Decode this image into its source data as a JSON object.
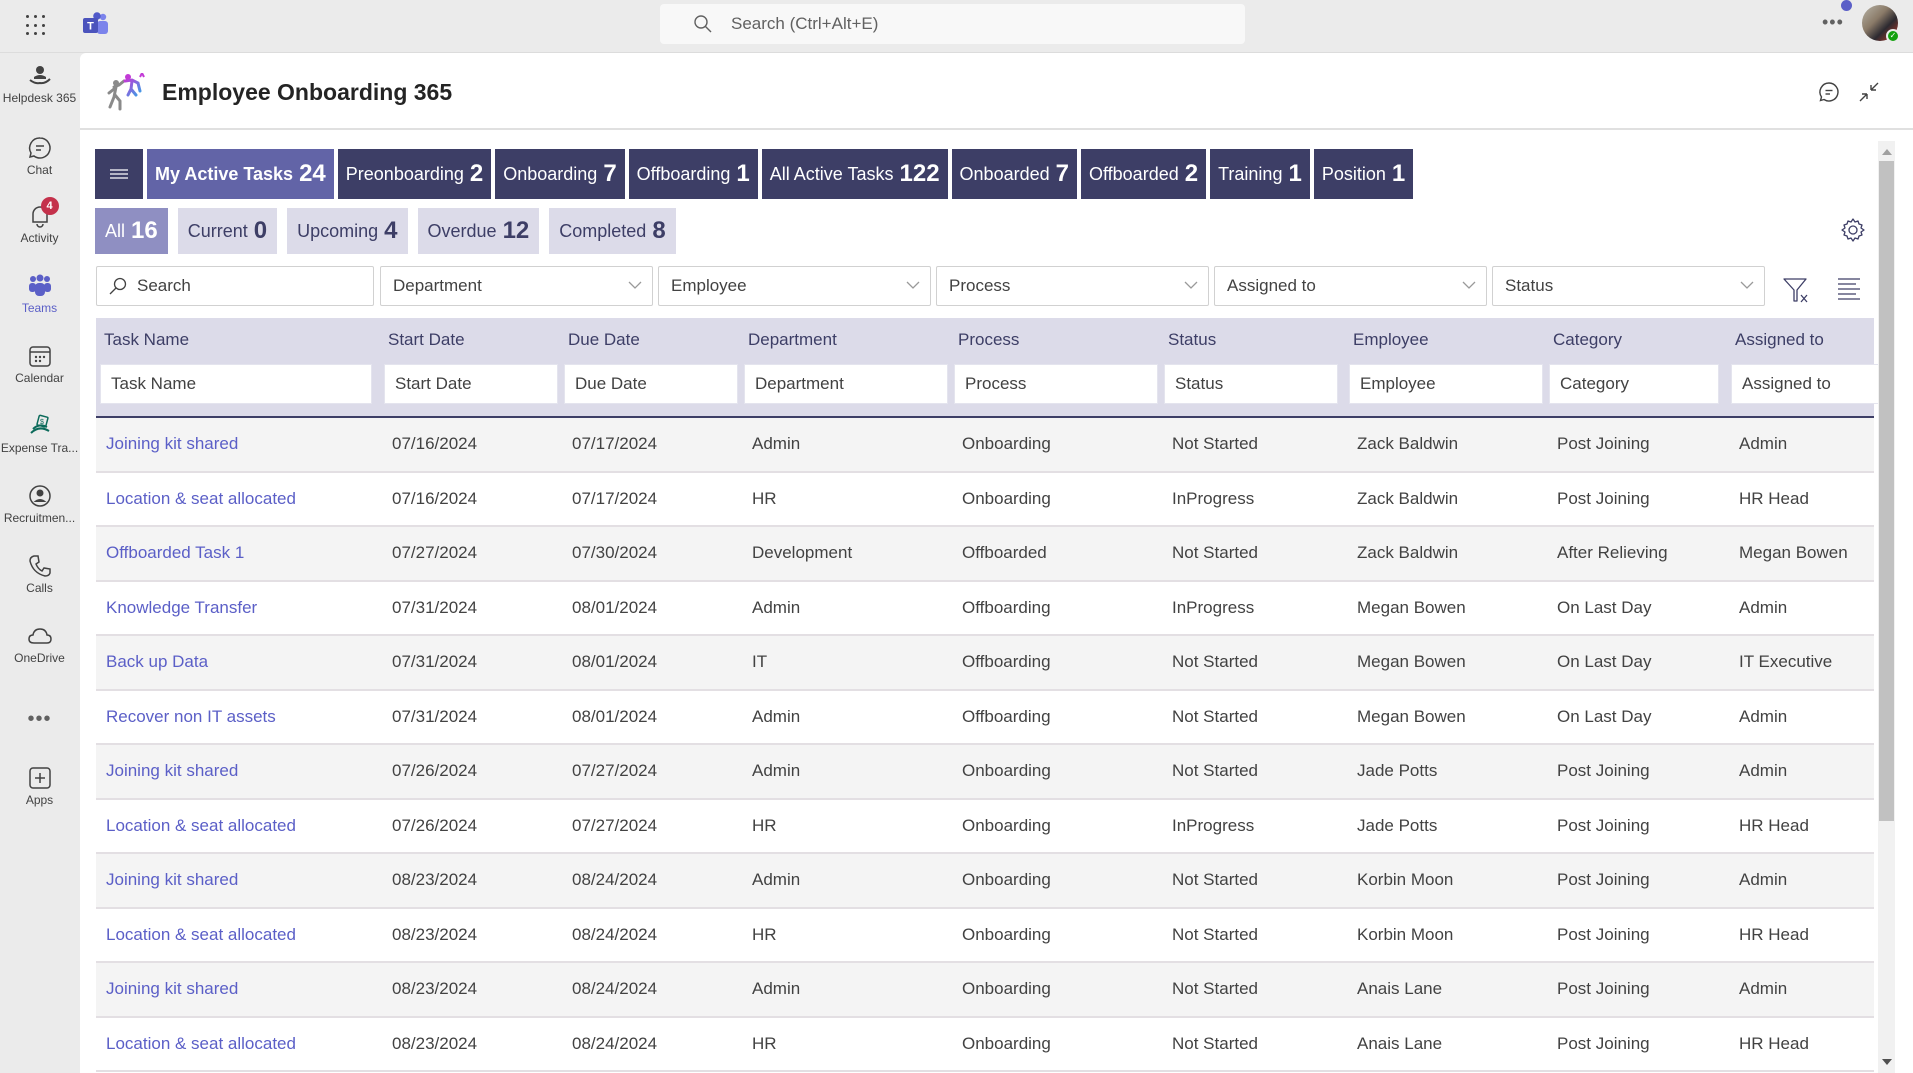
{
  "topbar": {
    "search_placeholder": "Search (Ctrl+Alt+E)",
    "more_label": "•••",
    "icons": [
      "app-launcher-icon",
      "teams-logo-icon",
      "search-icon",
      "more-icon",
      "avatar"
    ]
  },
  "sidebar": {
    "items": [
      {
        "label": "Helpdesk 365",
        "icon": "helpdesk-icon"
      },
      {
        "label": "Chat",
        "icon": "chat-icon"
      },
      {
        "label": "Activity",
        "icon": "bell-icon",
        "badge": "4"
      },
      {
        "label": "Teams",
        "icon": "teams-icon",
        "active": true
      },
      {
        "label": "Calendar",
        "icon": "calendar-icon"
      },
      {
        "label": "Expense Tra...",
        "icon": "expense-icon"
      },
      {
        "label": "Recruitmen...",
        "icon": "recruitment-icon"
      },
      {
        "label": "Calls",
        "icon": "phone-icon"
      },
      {
        "label": "OneDrive",
        "icon": "cloud-icon"
      },
      {
        "label": "Apps",
        "icon": "add-app-icon"
      }
    ],
    "more_label": "•••"
  },
  "app": {
    "title": "Employee Onboarding 365"
  },
  "tabs": [
    {
      "label": "My Active Tasks",
      "count": "24",
      "active": true
    },
    {
      "label": "Preonboarding",
      "count": "2"
    },
    {
      "label": "Onboarding",
      "count": "7"
    },
    {
      "label": "Offboarding",
      "count": "1"
    },
    {
      "label": "All Active Tasks",
      "count": "122"
    },
    {
      "label": "Onboarded",
      "count": "7"
    },
    {
      "label": "Offboarded",
      "count": "2"
    },
    {
      "label": "Training",
      "count": "1"
    },
    {
      "label": "Position",
      "count": "1"
    }
  ],
  "subtabs": [
    {
      "label": "All",
      "count": "16",
      "active": true
    },
    {
      "label": "Current",
      "count": "0"
    },
    {
      "label": "Upcoming",
      "count": "4"
    },
    {
      "label": "Overdue",
      "count": "12"
    },
    {
      "label": "Completed",
      "count": "8"
    }
  ],
  "filters": {
    "search_placeholder": "Search",
    "dropdowns": [
      "Department",
      "Employee",
      "Process",
      "Assigned to",
      "Status"
    ]
  },
  "table": {
    "columns": [
      "Task Name",
      "Start Date",
      "Due Date",
      "Department",
      "Process",
      "Status",
      "Employee",
      "Category",
      "Assigned to"
    ],
    "column_filters": [
      "Task Name",
      "Start Date",
      "Due Date",
      "Department",
      "Process",
      "Status",
      "Employee",
      "Category",
      "Assigned to"
    ],
    "rows": [
      [
        "Joining kit shared",
        "07/16/2024",
        "07/17/2024",
        "Admin",
        "Onboarding",
        "Not Started",
        "Zack Baldwin",
        "Post Joining",
        "Admin"
      ],
      [
        "Location & seat allocated",
        "07/16/2024",
        "07/17/2024",
        "HR",
        "Onboarding",
        "InProgress",
        "Zack Baldwin",
        "Post Joining",
        "HR Head"
      ],
      [
        "Offboarded Task 1",
        "07/27/2024",
        "07/30/2024",
        "Development",
        "Offboarded",
        "Not Started",
        "Zack Baldwin",
        "After Relieving",
        "Megan Bowen"
      ],
      [
        "Knowledge Transfer",
        "07/31/2024",
        "08/01/2024",
        "Admin",
        "Offboarding",
        "InProgress",
        "Megan Bowen",
        "On Last Day",
        "Admin"
      ],
      [
        "Back up Data",
        "07/31/2024",
        "08/01/2024",
        "IT",
        "Offboarding",
        "Not Started",
        "Megan Bowen",
        "On Last Day",
        "IT Executive"
      ],
      [
        "Recover non IT assets",
        "07/31/2024",
        "08/01/2024",
        "Admin",
        "Offboarding",
        "Not Started",
        "Megan Bowen",
        "On Last Day",
        "Admin"
      ],
      [
        "Joining kit shared",
        "07/26/2024",
        "07/27/2024",
        "Admin",
        "Onboarding",
        "Not Started",
        "Jade Potts",
        "Post Joining",
        "Admin"
      ],
      [
        "Location & seat allocated",
        "07/26/2024",
        "07/27/2024",
        "HR",
        "Onboarding",
        "InProgress",
        "Jade Potts",
        "Post Joining",
        "HR Head"
      ],
      [
        "Joining kit shared",
        "08/23/2024",
        "08/24/2024",
        "Admin",
        "Onboarding",
        "Not Started",
        "Korbin Moon",
        "Post Joining",
        "Admin"
      ],
      [
        "Location & seat allocated",
        "08/23/2024",
        "08/24/2024",
        "HR",
        "Onboarding",
        "Not Started",
        "Korbin Moon",
        "Post Joining",
        "HR Head"
      ],
      [
        "Joining kit shared",
        "08/23/2024",
        "08/24/2024",
        "Admin",
        "Onboarding",
        "Not Started",
        "Anais Lane",
        "Post Joining",
        "Admin"
      ],
      [
        "Location & seat allocated",
        "08/23/2024",
        "08/24/2024",
        "HR",
        "Onboarding",
        "Not Started",
        "Anais Lane",
        "Post Joining",
        "HR Head"
      ]
    ]
  },
  "colors": {
    "tab_dark": "#3d3e66",
    "tab_active": "#6264a7",
    "subtab": "#dcdbe9",
    "subtab_active": "#8f8fc2",
    "link": "#5b5fc7",
    "badge": "#c4314b"
  }
}
